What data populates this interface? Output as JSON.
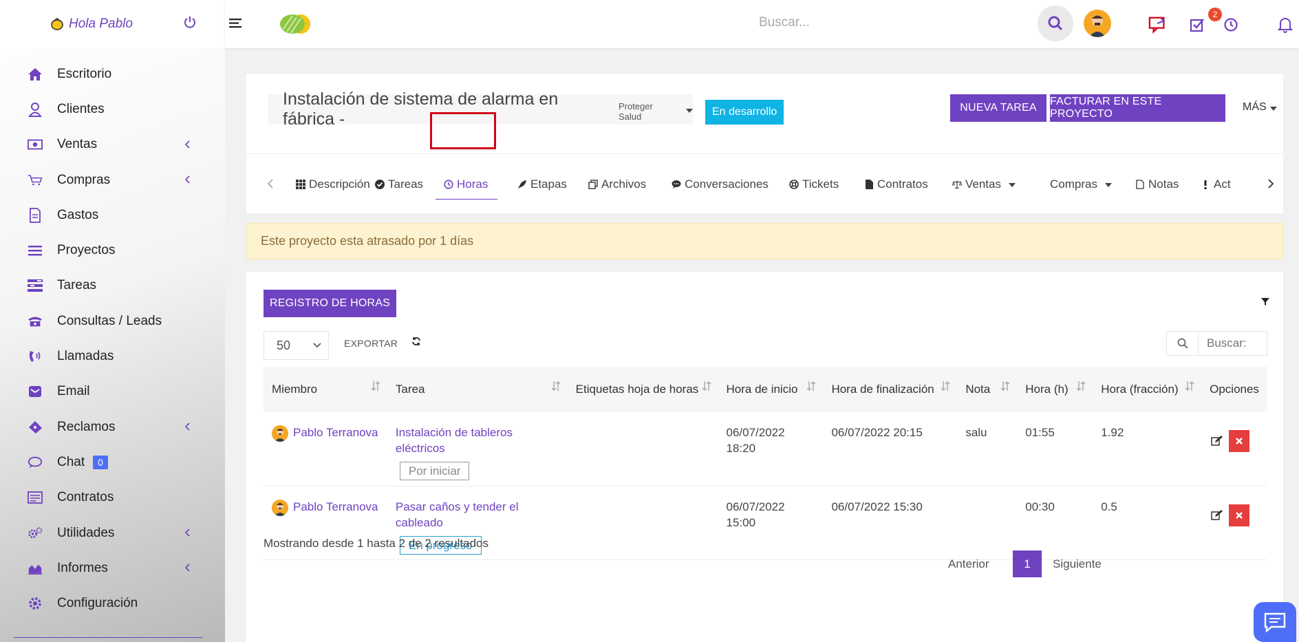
{
  "user": {
    "greeting": "Hola Pablo"
  },
  "topbar": {
    "search_placeholder": "Buscar...",
    "tasks_badge": "2"
  },
  "sidebar": {
    "items": [
      {
        "label": "Escritorio",
        "icon": "home-icon",
        "chevron": false
      },
      {
        "label": "Clientes",
        "icon": "user-icon",
        "chevron": false
      },
      {
        "label": "Ventas",
        "icon": "money-icon",
        "chevron": true
      },
      {
        "label": "Compras",
        "icon": "cart-icon",
        "chevron": true
      },
      {
        "label": "Gastos",
        "icon": "document-icon",
        "chevron": false
      },
      {
        "label": "Proyectos",
        "icon": "bars-icon",
        "chevron": false
      },
      {
        "label": "Tareas",
        "icon": "tasks-icon",
        "chevron": false
      },
      {
        "label": "Consultas / Leads",
        "icon": "phone-desk-icon",
        "chevron": false
      },
      {
        "label": "Llamadas",
        "icon": "phone-volume-icon",
        "chevron": false
      },
      {
        "label": "Email",
        "icon": "envelope-icon",
        "chevron": false
      },
      {
        "label": "Reclamos",
        "icon": "ticket-icon",
        "chevron": true
      },
      {
        "label": "Chat",
        "icon": "chat-icon",
        "chevron": false,
        "badge": "0"
      },
      {
        "label": "Contratos",
        "icon": "contract-icon",
        "chevron": false
      },
      {
        "label": "Utilidades",
        "icon": "cogs-icon",
        "chevron": true
      },
      {
        "label": "Informes",
        "icon": "area-chart-icon",
        "chevron": true
      },
      {
        "label": "Configuración",
        "icon": "gear-icon",
        "chevron": false
      }
    ]
  },
  "project": {
    "title": "Instalación de sistema de alarma en fábrica -",
    "client": "Proteger Salud",
    "status": "En desarrollo",
    "btn_new_task": "NUEVA TAREA",
    "btn_invoice": "FACTURAR EN ESTE PROYECTO",
    "more": "MÁS"
  },
  "tabs": [
    {
      "label": "Descripción",
      "icon": "grid-icon"
    },
    {
      "label": "Tareas",
      "icon": "check-circle-icon"
    },
    {
      "label": "Horas",
      "icon": "clock-icon",
      "active": true
    },
    {
      "label": "Etapas",
      "icon": "rocket-icon"
    },
    {
      "label": "Archivos",
      "icon": "files-icon"
    },
    {
      "label": "Conversaciones",
      "icon": "comment-icon"
    },
    {
      "label": "Tickets",
      "icon": "life-ring-icon"
    },
    {
      "label": "Contratos",
      "icon": "file-icon"
    },
    {
      "label": "Ventas",
      "icon": "scale-icon",
      "dropdown": true
    },
    {
      "label": "Compras",
      "icon": "cart-icon",
      "dropdown": true
    },
    {
      "label": "Notas",
      "icon": "note-icon"
    },
    {
      "label": "Act",
      "icon": "exclamation-icon"
    }
  ],
  "alert": "Este proyecto esta atrasado por 1 días",
  "timesheet": {
    "btn_register": "REGISTRO DE HORAS",
    "page_size": "50",
    "export": "EXPORTAR",
    "search_placeholder": "Buscar:",
    "columns": [
      "Miembro",
      "Tarea",
      "Etiquetas hoja de horas",
      "Hora de inicio",
      "Hora de finalización",
      "Nota",
      "Hora (h)",
      "Hora (fracción)",
      "Opciones"
    ],
    "rows": [
      {
        "member": "Pablo Terranova",
        "task": "Instalación de tableros eléctricos",
        "status": "Por iniciar",
        "tags": "",
        "start": "06/07/2022 18:20",
        "end": "06/07/2022 20:15",
        "note": "salu",
        "hours": "01:55",
        "fraction": "1.92"
      },
      {
        "member": "Pablo Terranova",
        "task": "Pasar caños y tender el cableado",
        "status": "En progreso",
        "tags": "",
        "start": "06/07/2022 15:00",
        "end": "06/07/2022 15:30",
        "note": "",
        "hours": "00:30",
        "fraction": "0.5"
      }
    ],
    "showing": "Mostrando desde 1 hasta 2 de 2 resultados",
    "prev": "Anterior",
    "page": "1",
    "next": "Siguiente"
  },
  "colors": {
    "accent": "#6f42c1",
    "info": "#0fb4e4",
    "danger": "#e53e3e",
    "warning_bg": "#fdf3d1"
  }
}
